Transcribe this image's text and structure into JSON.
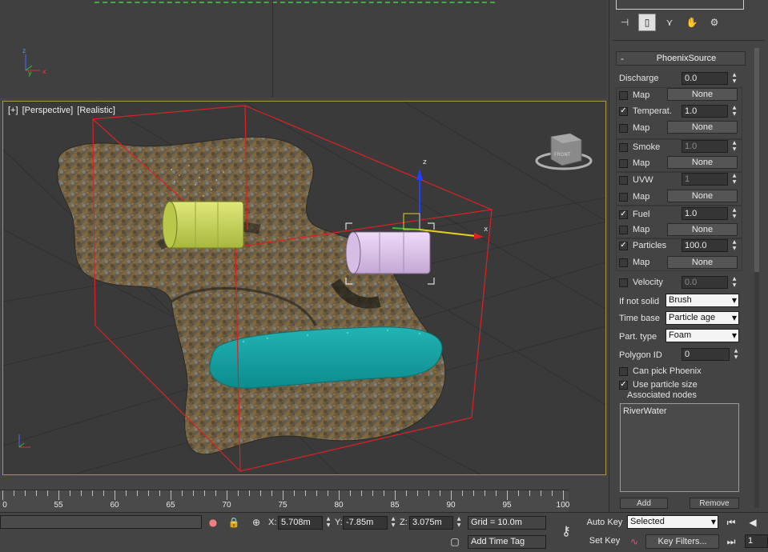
{
  "viewports": {
    "top": {
      "axis_y": "y",
      "axis_x": "x",
      "axis_z": "z"
    },
    "perspective": {
      "label_plus": "[+]",
      "label_view": "[Perspective]",
      "label_shading": "[Realistic]",
      "gizmo_x": "x",
      "gizmo_z": "z",
      "viewcube_text": "FRONT"
    }
  },
  "command_panel": {
    "tabs": [
      {
        "icon": "hierarchy-icon",
        "glyph": "⊣"
      },
      {
        "icon": "modify-icon",
        "glyph": "▯"
      },
      {
        "icon": "motion-icon",
        "glyph": "⋎"
      },
      {
        "icon": "display-icon",
        "glyph": "✋"
      },
      {
        "icon": "utilities-icon",
        "glyph": "⚙"
      }
    ],
    "rollout_title": "PhoenixSource",
    "rollout_toggle": "-",
    "discharge": {
      "label": "Discharge",
      "value": "0.0"
    },
    "rows": [
      {
        "label": "Map",
        "checked": false,
        "button": "None"
      },
      {
        "label": "Temperat.",
        "checked": true,
        "value": "1.0"
      },
      {
        "label": "Map",
        "checked": false,
        "button": "None"
      },
      {
        "label": "Smoke",
        "checked": false,
        "value": "1.0"
      },
      {
        "label": "Map",
        "checked": false,
        "button": "None"
      },
      {
        "label": "UVW",
        "checked": false,
        "value": "1"
      },
      {
        "label": "Map",
        "checked": false,
        "button": "None"
      },
      {
        "label": "Fuel",
        "checked": true,
        "value": "1.0"
      },
      {
        "label": "Map",
        "checked": false,
        "button": "None"
      },
      {
        "label": "Particles",
        "checked": true,
        "value": "100.0"
      },
      {
        "label": "Map",
        "checked": false,
        "button": "None"
      },
      {
        "label": "Velocity",
        "checked": false,
        "value": "0.0"
      }
    ],
    "if_not_solid": {
      "label": "If not solid",
      "value": "Brush"
    },
    "time_base": {
      "label": "Time base",
      "value": "Particle age"
    },
    "part_type": {
      "label": "Part. type",
      "value": "Foam"
    },
    "polygon_id": {
      "label": "Polygon ID",
      "value": "0"
    },
    "can_pick_phoenix": {
      "label": "Can pick Phoenix",
      "checked": false
    },
    "use_particle_size": {
      "label": "Use particle size",
      "checked": true
    },
    "associated_nodes": {
      "label": "Associated nodes",
      "items": [
        "RiverWater"
      ]
    },
    "add_button": "Add",
    "remove_button": "Remove"
  },
  "timeline": {
    "ticks": [
      "0",
      "55",
      "60",
      "65",
      "70",
      "75",
      "80",
      "85",
      "90",
      "95",
      "100"
    ]
  },
  "statusbar": {
    "x_label": "X:",
    "x_value": "5.708m",
    "y_label": "Y:",
    "y_value": "-7.85m",
    "z_label": "Z:",
    "z_value": "3.075m",
    "grid": "Grid = 10.0m",
    "add_time_tag": "Add Time Tag",
    "auto_key": "Auto Key",
    "set_key": "Set Key",
    "selected": "Selected",
    "key_filters": "Key Filters...",
    "frame": "1"
  },
  "colors": {
    "viewport_border": "#b09540",
    "bbox_red": "#e02020",
    "water": "#1aa0a0",
    "barrel_yellow": "#c9d85a",
    "barrel_pink": "#e0c8ee"
  }
}
